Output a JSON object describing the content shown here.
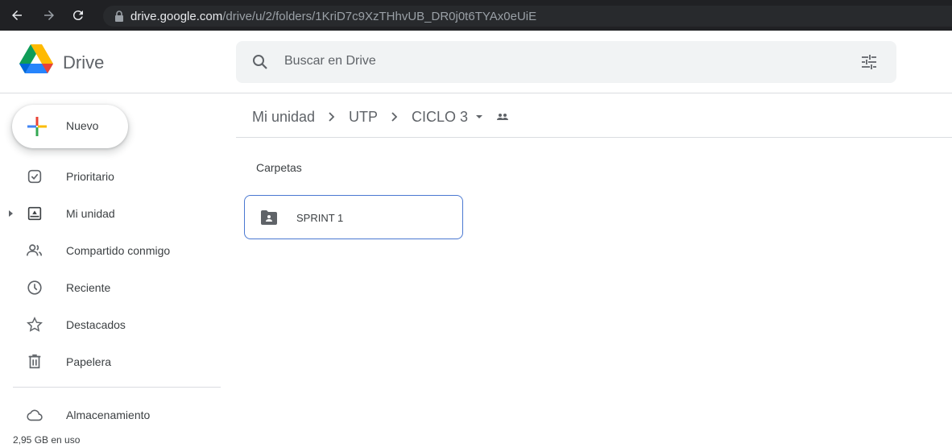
{
  "browser": {
    "url_host": "drive.google.com",
    "url_path": "/drive/u/2/folders/1KriD7c9XzTHhvUB_DR0j0t6TYAx0eUiE"
  },
  "header": {
    "brand": "Drive",
    "search_placeholder": "Buscar en Drive"
  },
  "sidebar": {
    "new_label": "Nuevo",
    "items": [
      {
        "label": "Prioritario",
        "icon": "priority-icon"
      },
      {
        "label": "Mi unidad",
        "icon": "my-drive-icon"
      },
      {
        "label": "Compartido conmigo",
        "icon": "shared-icon"
      },
      {
        "label": "Reciente",
        "icon": "clock-icon"
      },
      {
        "label": "Destacados",
        "icon": "star-icon"
      },
      {
        "label": "Papelera",
        "icon": "trash-icon"
      },
      {
        "label": "Almacenamiento",
        "icon": "cloud-icon"
      }
    ],
    "storage_used": "2,95 GB en uso"
  },
  "main": {
    "breadcrumb": [
      "Mi unidad",
      "UTP",
      "CICLO 3"
    ],
    "section_title": "Carpetas",
    "folders": [
      {
        "name": "SPRINT 1"
      }
    ]
  },
  "colors": {
    "accent": "#4a78d1",
    "browser_bg": "#202124",
    "search_bg": "#f1f3f4"
  }
}
